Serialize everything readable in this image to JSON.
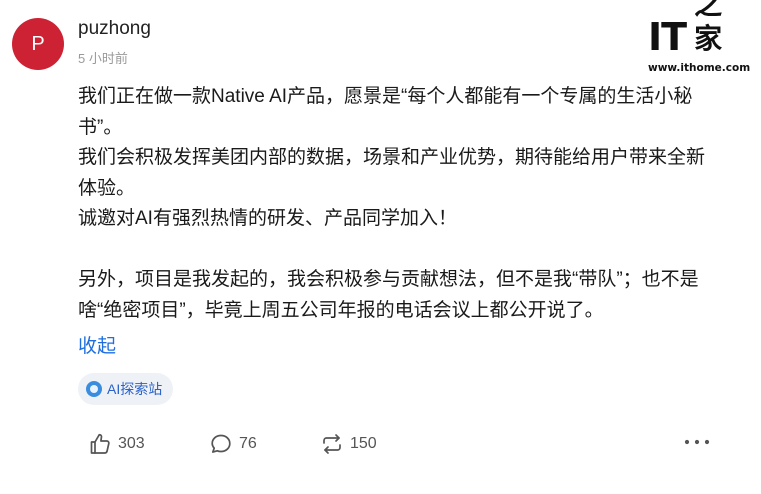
{
  "post": {
    "avatar_letter": "P",
    "avatar_color": "#cc2233",
    "username": "puzhong",
    "timestamp": "5 小时前",
    "paragraphs": [
      "我们正在做一款Native AI产品，愿景是“每个人都能有一个专属的生活小秘书”。",
      "我们会积极发挥美团内部的数据，场景和产业优势，期待能给用户带来全新体验。",
      "诚邀对AI有强烈热情的研发、产品同学加入！",
      "另外，项目是我发起的，我会积极参与贡献想法，但不是我“带队”；也不是啥“绝密项目”，毕竟上周五公司年报的电话会议上都公开说了。"
    ],
    "collapse_label": "收起",
    "tag_label": "AI探索站"
  },
  "watermark": {
    "logo_text": "IT",
    "logo_cn": "之家",
    "site_url": "www.ithome.com"
  },
  "actions": {
    "like_count": "303",
    "comment_count": "76",
    "repost_count": "150",
    "like_icon": "thumbs-up-icon",
    "comment_icon": "speech-bubble-icon",
    "repost_icon": "repost-arrows-icon",
    "more_icon": "more-dots-icon"
  },
  "colors": {
    "link_blue": "#1e6fdd",
    "tag_background": "#eef1f6",
    "muted_text": "#9a9a9a"
  }
}
